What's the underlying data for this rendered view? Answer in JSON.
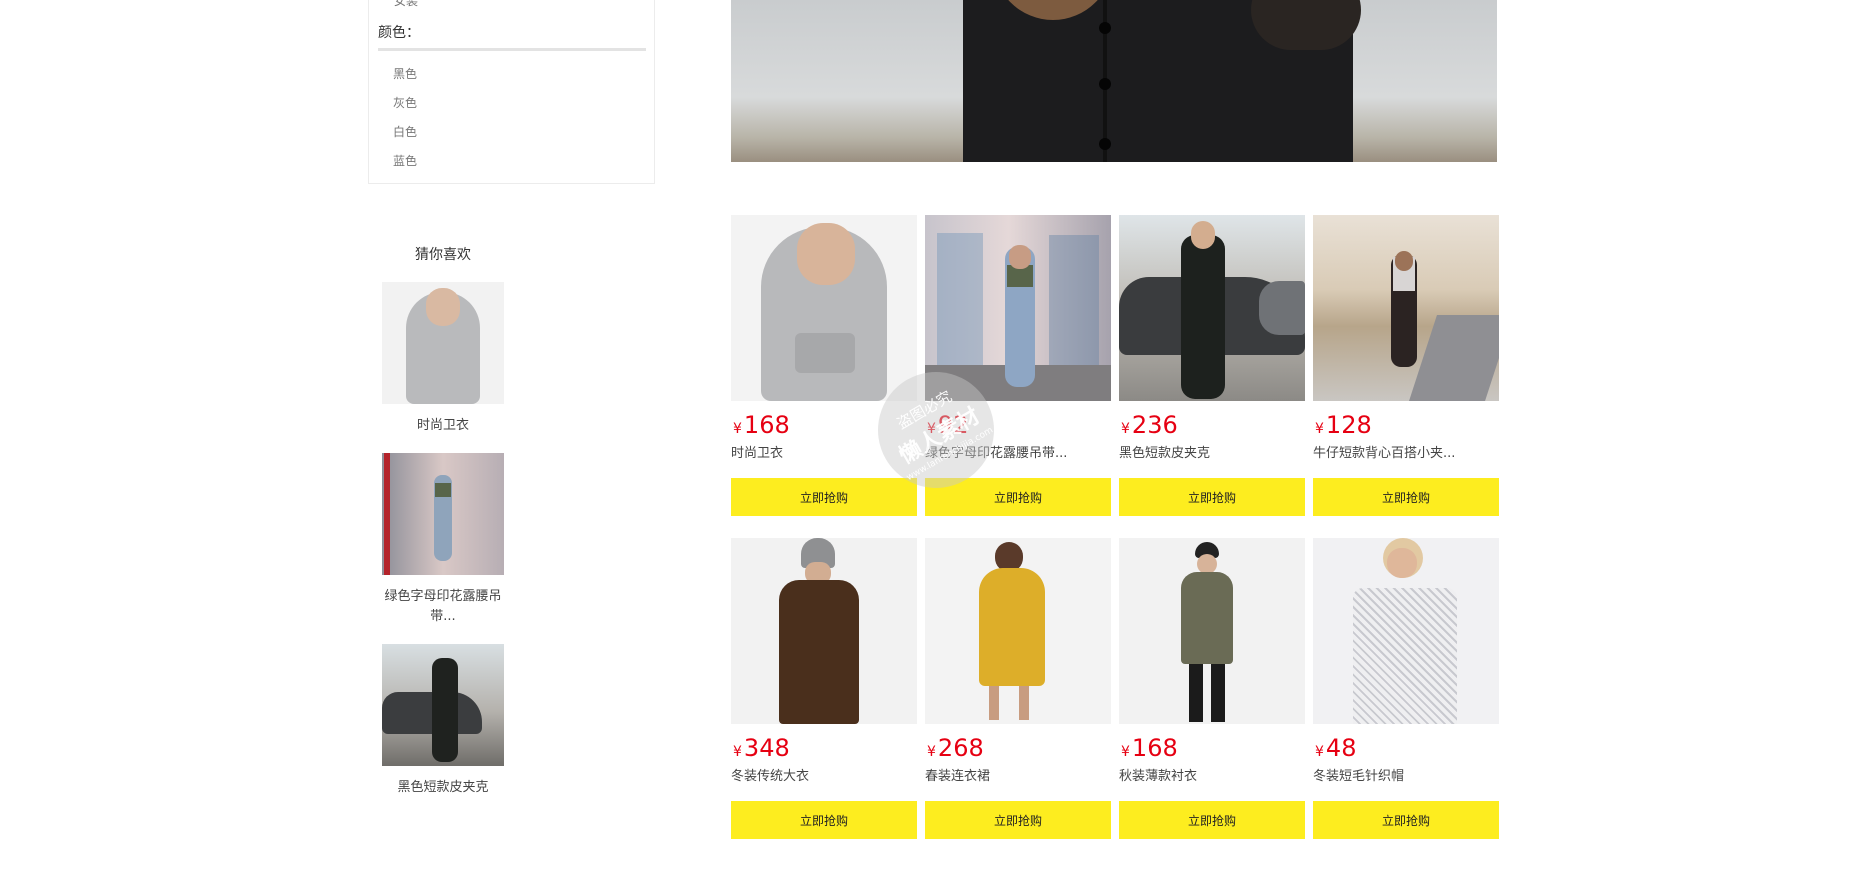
{
  "filter": {
    "previous_item": "女装",
    "color_title": "颜色：",
    "colors": [
      "黑色",
      "灰色",
      "白色",
      "蓝色"
    ]
  },
  "guess": {
    "title": "猜你喜欢",
    "items": [
      {
        "name": "时尚卫衣"
      },
      {
        "name": "绿色字母印花露腰吊带..."
      },
      {
        "name": "黑色短款皮夹克"
      }
    ]
  },
  "currency_symbol": "¥",
  "products": [
    {
      "price": "168",
      "name": "时尚卫衣",
      "buy": "立即抢购"
    },
    {
      "price": "92",
      "name": "绿色字母印花露腰吊带...",
      "buy": "立即抢购"
    },
    {
      "price": "236",
      "name": "黑色短款皮夹克",
      "buy": "立即抢购"
    },
    {
      "price": "128",
      "name": "牛仔短款背心百搭小夹...",
      "buy": "立即抢购"
    },
    {
      "price": "348",
      "name": "冬装传统大衣",
      "buy": "立即抢购"
    },
    {
      "price": "268",
      "name": "春装连衣裙",
      "buy": "立即抢购"
    },
    {
      "price": "168",
      "name": "秋装薄款衬衣",
      "buy": "立即抢购"
    },
    {
      "price": "48",
      "name": "冬装短毛针织帽",
      "buy": "立即抢购"
    }
  ],
  "watermark": {
    "line1": "盗图必究",
    "line2": "懒人素材",
    "line3": "www.lanrenzhijia.com"
  },
  "colors": {
    "price": "#e60012",
    "buy_button": "#fded1f"
  }
}
